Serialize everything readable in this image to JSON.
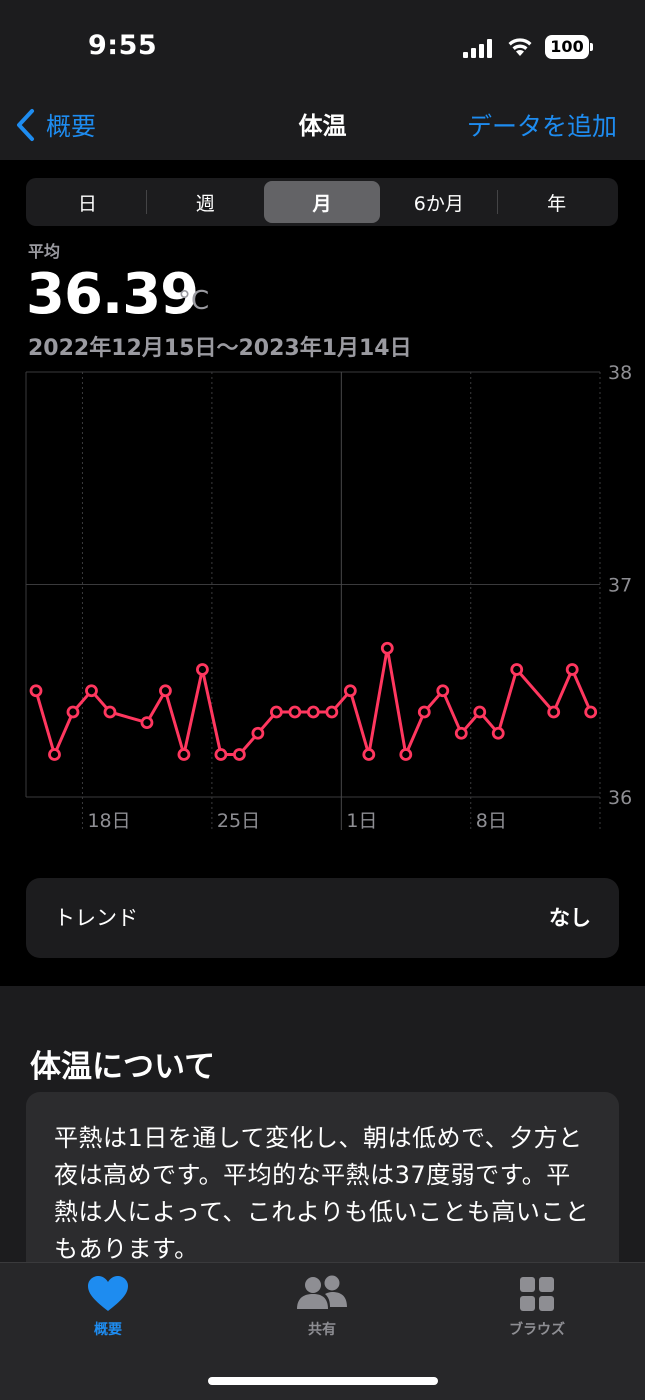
{
  "status_bar": {
    "time": "9:55",
    "battery": "100"
  },
  "nav": {
    "back_label": "概要",
    "title": "体温",
    "action_label": "データを追加"
  },
  "range_tabs": [
    {
      "label": "日"
    },
    {
      "label": "週"
    },
    {
      "label": "月",
      "selected": true
    },
    {
      "label": "6か月"
    },
    {
      "label": "年"
    }
  ],
  "summary": {
    "label": "平均",
    "value": "36.39",
    "unit": "°C",
    "date_range": "2022年12月15日〜2023年1月14日"
  },
  "chart_data": {
    "type": "line",
    "x": [
      "12/15",
      "12/16",
      "12/17",
      "12/18",
      "12/19",
      "12/20",
      "12/21",
      "12/22",
      "12/23",
      "12/24",
      "12/25",
      "12/26",
      "12/27",
      "12/28",
      "12/29",
      "12/30",
      "12/31",
      "1/1",
      "1/2",
      "1/3",
      "1/4",
      "1/5",
      "1/6",
      "1/7",
      "1/8",
      "1/9",
      "1/10",
      "1/11",
      "1/12",
      "1/13",
      "1/14"
    ],
    "series": [
      {
        "values": [
          36.5,
          36.2,
          36.4,
          36.5,
          36.4,
          null,
          36.35,
          36.5,
          36.2,
          36.6,
          36.2,
          36.2,
          36.3,
          36.4,
          36.4,
          36.4,
          36.4,
          36.5,
          36.2,
          36.7,
          36.2,
          36.4,
          36.5,
          36.3,
          36.4,
          36.3,
          36.6,
          null,
          36.4,
          36.6,
          36.4
        ]
      }
    ],
    "ylim": [
      36,
      38
    ],
    "y_ticks": [
      "38",
      "37",
      "36"
    ],
    "x_tick_labels": [
      "18日",
      "25日",
      "1日",
      "8日"
    ],
    "grid": true,
    "line_color": "#ff375f"
  },
  "trend": {
    "label": "トレンド",
    "value": "なし"
  },
  "about": {
    "title": "体温について",
    "text": "平熱は1日を通して変化し、朝は低めで、夕方と夜は高めです。平均的な平熱は37度弱です。平熱は人によって、これよりも低いことも高いこともあります。"
  },
  "tab_bar": {
    "items": [
      {
        "label": "概要",
        "icon": "heart-icon",
        "active": true
      },
      {
        "label": "共有",
        "icon": "people-icon"
      },
      {
        "label": "ブラウズ",
        "icon": "grid-icon"
      }
    ]
  },
  "colors": {
    "accent": "#1e8cf0",
    "chart_line": "#ff375f"
  }
}
